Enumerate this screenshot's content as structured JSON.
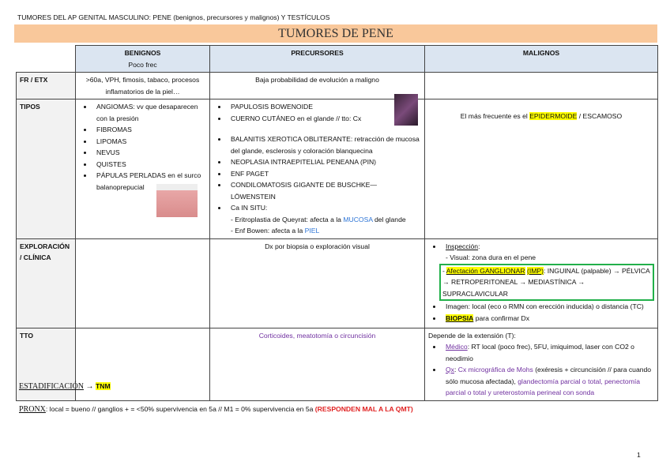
{
  "header": "TUMORES DEL AP GENITAL MASCULINO: PENE (benignos, precursores y malignos) Y TESTÍCULOS",
  "title": "TUMORES DE PENE",
  "columns": {
    "benignos": "BENIGNOS",
    "benignos_sub": "Poco frec",
    "precursores": "PRECURSORES",
    "malignos": "MALIGNOS"
  },
  "rows": {
    "fr": {
      "label": "FR / ETX",
      "benignos": ">60a, VPH, fimosis, tabaco, procesos inflamatorios de la piel…",
      "precursores": "Baja probabilidad de evolución a maligno"
    },
    "tipos": {
      "label": "TIPOS",
      "benignos": [
        "ANGIOMAS: vv que desaparecen con la presión",
        "FIBROMAS",
        "LIPOMAS",
        "NEVUS",
        "QUISTES",
        "PÁPULAS PERLADAS en el surco balanoprepucial"
      ],
      "precursores": [
        "PAPULOSIS BOWENOIDE",
        "CUERNO CUTÁNEO en el glande // tto: Cx",
        "BALANITIS XEROTICA OBLITERANTE: retracción de mucosa del glande, esclerosis y coloración blanquecina",
        "NEOPLASIA INTRAEPITELIAL PENEANA (PIN)",
        "ENF PAGET",
        "CONDILOMATOSIS GIGANTE DE BUSCHKE—LÖWENSTEIN",
        "Ca IN SITU:"
      ],
      "insitu": {
        "a": "- Eritroplastia de Queyrat: afecta a la ",
        "a_hl": "MUCOSA",
        "a_end": " del glande",
        "b": "- Enf Bowen: afecta a la ",
        "b_hl": "PIEL"
      },
      "malignos": {
        "pre": "El más frecuente es el ",
        "hl": "EPIDERMOIDE",
        "post": " / ESCAMOSO"
      }
    },
    "exploracion": {
      "label": "EXPLORACIÓN / CLÍNICA",
      "precursores": "Dx por biopsia o exploración visual",
      "inspeccion": "Inspección",
      "visual": "- Visual: zona dura en el pene",
      "afect": "Afectación GANGLIONAR",
      "imp": "(IMP)",
      "afect_rest": ": INGUINAL (palpable) → PÉLVICA → RETROPERITONEAL → MEDIASTÍNICA → SUPRACLAVICULAR",
      "imagen": "Imagen: local (eco o RMN con erección inducida) o distancia (TC)",
      "biopsia": "BIOPSIA",
      "biopsia_rest": " para confirmar Dx"
    },
    "tto": {
      "label": "TTO",
      "precursores": "Corticoides, meatotomía o circuncisión",
      "malignos_intro": "Depende de la extensión (T):",
      "medico": "Médico",
      "medico_rest": ": RT local (poco frec), 5FU, imiquimod, laser con CO2 o neodimio",
      "qx": "Qx",
      "qx_a": ": ",
      "qx_mohs": "Cx micrográfica de Mohs",
      "qx_b": " (exéresis + circuncisión // para cuando sólo mucosa afectada), ",
      "qx_c": "glandectomía parcial o total, penectomía parcial o total y ureterostomía perineal con sonda"
    }
  },
  "estadificacion": {
    "label": "ESTADIFICACIÓN",
    "arrow": " → ",
    "tnm": "TNM"
  },
  "pronx": {
    "label": "PRONX",
    "text": ": local = bueno // ganglios + = <50% supervivencia en 5a // M1 = 0% supervivencia en 5a ",
    "red": "(RESPONDEN MAL A LA QMT)"
  },
  "page_number": "1"
}
